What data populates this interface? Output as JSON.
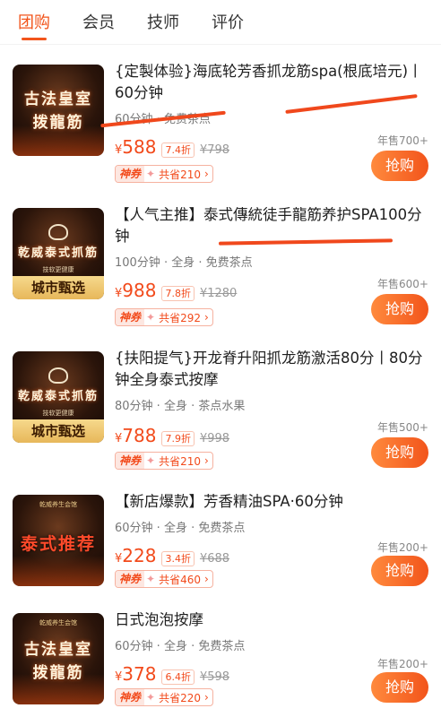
{
  "tabs": [
    {
      "label": "团购"
    },
    {
      "label": "会员"
    },
    {
      "label": "技师"
    },
    {
      "label": "评价"
    }
  ],
  "items": [
    {
      "title": "{定製体验}海底轮芳香抓龙筋spa(根底培元)丨60分钟",
      "meta": "60分钟 · 免费茶点",
      "price": "588",
      "currency": "¥",
      "discount": "7.4折",
      "original": "¥798",
      "coupon_tag": "神券",
      "coupon_save": "共省210",
      "sales": "年售700+",
      "buy": "抢购",
      "image": {
        "brand": "",
        "lines": [
          "古法皇室",
          "拨龍筋"
        ],
        "sub": "",
        "city": ""
      }
    },
    {
      "title": "【人气主推】泰式傳統徒手龍筋养护SPA100分钟",
      "meta": "100分钟 · 全身 · 免费茶点",
      "price": "988",
      "currency": "¥",
      "discount": "7.8折",
      "original": "¥1280",
      "coupon_tag": "神券",
      "coupon_save": "共省292",
      "sales": "年售600+",
      "buy": "抢购",
      "image": {
        "brand": "",
        "lines": [
          "乾威泰式抓筋"
        ],
        "sub": "技软更健康",
        "city": "城市甄选"
      }
    },
    {
      "title": "{扶阳提气}开龙脊升阳抓龙筋激活80分丨80分钟全身泰式按摩",
      "meta": "80分钟 · 全身 · 茶点水果",
      "price": "788",
      "currency": "¥",
      "discount": "7.9折",
      "original": "¥998",
      "coupon_tag": "神券",
      "coupon_save": "共省210",
      "sales": "年售500+",
      "buy": "抢购",
      "image": {
        "brand": "",
        "lines": [
          "乾威泰式抓筋"
        ],
        "sub": "技软更健康",
        "city": "城市甄选"
      }
    },
    {
      "title": "【新店爆款】芳香精油SPA·60分钟",
      "meta": "60分钟 · 全身 · 免费茶点",
      "price": "228",
      "currency": "¥",
      "discount": "3.4折",
      "original": "¥688",
      "coupon_tag": "神券",
      "coupon_save": "共省460",
      "sales": "年售200+",
      "buy": "抢购",
      "image": {
        "brand": "乾威养生会馆",
        "lines": [
          "泰式推荐"
        ],
        "sub": "",
        "city": ""
      }
    },
    {
      "title": "日式泡泡按摩",
      "meta": "60分钟 · 全身 · 免费茶点",
      "price": "378",
      "currency": "¥",
      "discount": "6.4折",
      "original": "¥598",
      "coupon_tag": "神券",
      "coupon_save": "共省220",
      "sales": "年售200+",
      "buy": "抢购",
      "image": {
        "brand": "乾威养生会馆",
        "lines": [
          "古法皇室",
          "拨龍筋"
        ],
        "sub": "",
        "city": ""
      }
    }
  ],
  "colors": {
    "accent": "#f2541b",
    "price": "#f24a1b",
    "scribble": "#f0481c"
  }
}
